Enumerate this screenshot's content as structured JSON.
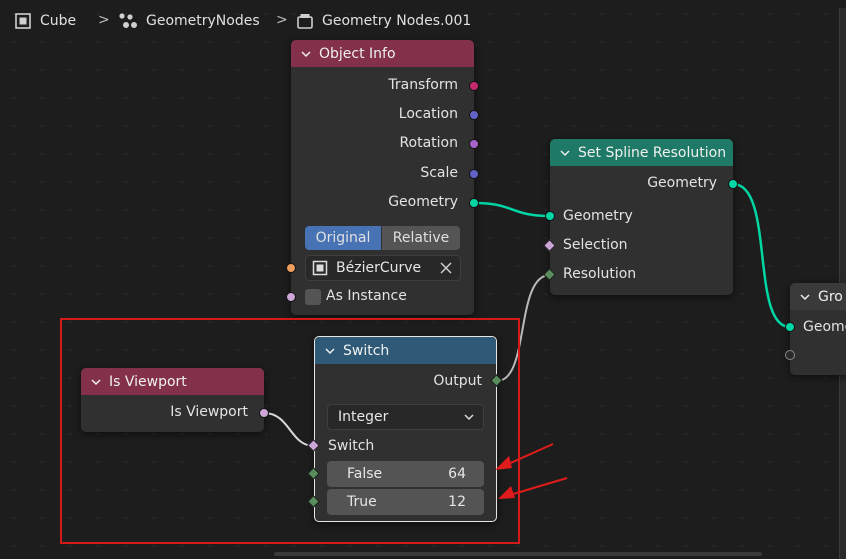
{
  "breadcrumb": {
    "object": "Cube",
    "modifier": "GeometryNodes",
    "node_group": "Geometry Nodes.001"
  },
  "nodes": {
    "object_info": {
      "title": "Object Info",
      "outputs": [
        "Transform",
        "Location",
        "Rotation",
        "Scale",
        "Geometry"
      ],
      "mode_buttons": [
        "Original",
        "Relative"
      ],
      "active_mode": "Original",
      "object_field": "BézierCurve",
      "as_instance": "As Instance"
    },
    "set_spline_resolution": {
      "title": "Set Spline Resolution",
      "output": "Geometry",
      "inputs": [
        "Geometry",
        "Selection",
        "Resolution"
      ]
    },
    "group_output": {
      "title": "Gro",
      "input": "Geome"
    },
    "is_viewport": {
      "title": "Is Viewport",
      "output": "Is Viewport"
    },
    "switch": {
      "title": "Switch",
      "output": "Output",
      "type": "Integer",
      "switch_label": "Switch",
      "false_label": "False",
      "false_value": "64",
      "true_label": "True",
      "true_value": "12"
    }
  },
  "colors": {
    "geometry_socket": "#00d6a3",
    "matrix_socket": "#c7296f",
    "vector_socket": "#6363c7",
    "rotation_socket": "#a663c7",
    "object_socket": "#ed9e5c",
    "boolean_socket": "#cca6d6",
    "integer_socket": "#598c5c",
    "highlight": "#d21a1a"
  }
}
